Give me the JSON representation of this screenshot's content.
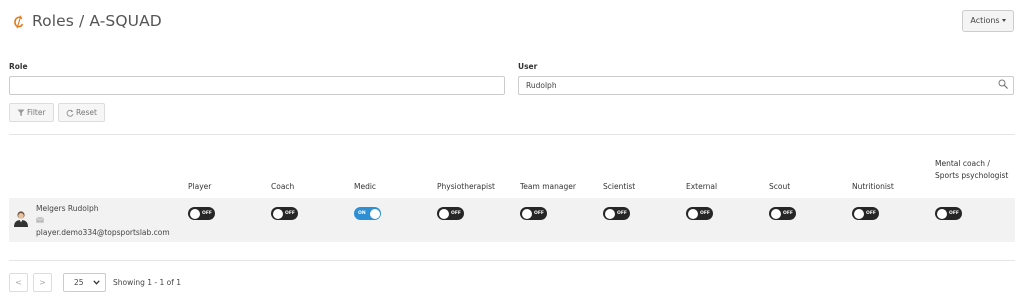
{
  "header": {
    "title": "Roles / A-SQUAD",
    "actions_label": "Actions",
    "brand_color": "#e07b1d"
  },
  "filters": {
    "role_label": "Role",
    "role_value": "",
    "user_label": "User",
    "user_value": "Rudolph",
    "filter_label": "Filter",
    "reset_label": "Reset"
  },
  "table": {
    "columns": [
      "Player",
      "Coach",
      "Medic",
      "Physiotherapist",
      "Team manager",
      "Scientist",
      "External",
      "Scout",
      "Nutritionist",
      "Mental coach / Sports psychologist"
    ],
    "rows": [
      {
        "name": "Melgers Rudolph",
        "email": "player.demo334@topsportslab.com",
        "roles": [
          {
            "label": "OFF",
            "on": false
          },
          {
            "label": "OFF",
            "on": false
          },
          {
            "label": "ON",
            "on": true
          },
          {
            "label": "OFF",
            "on": false
          },
          {
            "label": "OFF",
            "on": false
          },
          {
            "label": "OFF",
            "on": false
          },
          {
            "label": "OFF",
            "on": false
          },
          {
            "label": "OFF",
            "on": false
          },
          {
            "label": "OFF",
            "on": false
          },
          {
            "label": "OFF",
            "on": false
          }
        ]
      }
    ],
    "toggle_on_color": "#2e8fd4",
    "toggle_off_color": "#262626"
  },
  "pagination": {
    "prev_label": "<",
    "next_label": ">",
    "page_size": "25",
    "showing_text": "Showing 1 - 1 of 1"
  }
}
